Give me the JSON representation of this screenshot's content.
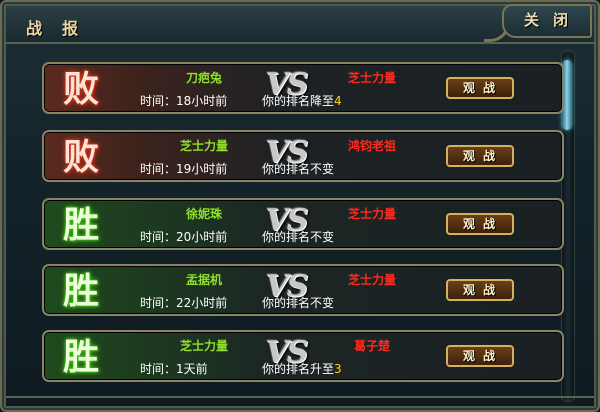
{
  "header": {
    "title": "战报",
    "close_label": "关闭"
  },
  "watch_label": "观战",
  "time_prefix": "时间：",
  "rank_prefix": "你的排名",
  "vs": "VS",
  "rows": [
    {
      "result": "败",
      "outcome": "lose",
      "player1": "刀疤兔",
      "player1_color": "green",
      "player2": "芝士力量",
      "player2_color": "red",
      "time": "18小时前",
      "rank_text": "降至",
      "rank_num": "4"
    },
    {
      "result": "败",
      "outcome": "lose",
      "player1": "芝士力量",
      "player1_color": "green",
      "player2": "鸿钧老祖",
      "player2_color": "red",
      "time": "19小时前",
      "rank_text": "不变",
      "rank_num": ""
    },
    {
      "result": "胜",
      "outcome": "win",
      "player1": "徐妮珠",
      "player1_color": "green",
      "player2": "芝士力量",
      "player2_color": "red",
      "time": "20小时前",
      "rank_text": "不变",
      "rank_num": ""
    },
    {
      "result": "胜",
      "outcome": "win",
      "player1": "盂据机",
      "player1_color": "green",
      "player2": "芝士力量",
      "player2_color": "red",
      "time": "22小时前",
      "rank_text": "不变",
      "rank_num": ""
    },
    {
      "result": "胜",
      "outcome": "win",
      "player1": "芝士力量",
      "player1_color": "green",
      "player2": "葛子楚",
      "player2_color": "red",
      "time": "1天前",
      "rank_text": "升至",
      "rank_num": "3"
    }
  ],
  "colors": {
    "green": "#8ee02a",
    "red": "#ff2a1f",
    "rank_number": "#ffd21c"
  }
}
